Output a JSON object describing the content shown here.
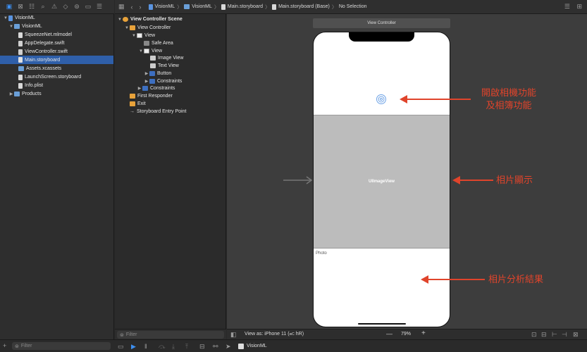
{
  "navigator": {
    "items": [
      {
        "label": "VisionML",
        "type": "project",
        "indent": 0,
        "expanded": true
      },
      {
        "label": "VisionML",
        "type": "folder",
        "indent": 1,
        "expanded": true
      },
      {
        "label": "SqueezeNet.mlmodel",
        "type": "file",
        "indent": 2
      },
      {
        "label": "AppDelegate.swift",
        "type": "swift",
        "indent": 2
      },
      {
        "label": "ViewController.swift",
        "type": "swift",
        "indent": 2
      },
      {
        "label": "Main.storyboard",
        "type": "storyboard",
        "indent": 2,
        "selected": true
      },
      {
        "label": "Assets.xcassets",
        "type": "folder",
        "indent": 2
      },
      {
        "label": "LaunchScreen.storyboard",
        "type": "storyboard",
        "indent": 2
      },
      {
        "label": "Info.plist",
        "type": "file",
        "indent": 2
      },
      {
        "label": "Products",
        "type": "folder",
        "indent": 1,
        "expanded": false
      }
    ],
    "filter_placeholder": "Filter"
  },
  "breadcrumb": [
    "VisionML",
    "VisionML",
    "Main.storyboard",
    "Main.storyboard (Base)",
    "No Selection"
  ],
  "outline": {
    "items": [
      {
        "label": "View Controller Scene",
        "indent": 0
      },
      {
        "label": "View Controller",
        "indent": 1
      },
      {
        "label": "View",
        "indent": 2
      },
      {
        "label": "Safe Area",
        "indent": 3
      },
      {
        "label": "View",
        "indent": 3
      },
      {
        "label": "Image View",
        "indent": 4
      },
      {
        "label": "Text View",
        "indent": 4
      },
      {
        "label": "Button",
        "indent": 4
      },
      {
        "label": "Constraints",
        "indent": 4
      },
      {
        "label": "Constraints",
        "indent": 3
      },
      {
        "label": "First Responder",
        "indent": 1
      },
      {
        "label": "Exit",
        "indent": 1
      },
      {
        "label": "Storyboard Entry Point",
        "indent": 1
      }
    ],
    "filter_placeholder": "Filter"
  },
  "canvas": {
    "scene_title": "View Controller",
    "image_view_label": "UIImageView",
    "text_view_label": "Photo"
  },
  "annotations": {
    "camera": [
      "開啟相機功能",
      "及相簿功能"
    ],
    "photo": "相片顯示",
    "result": "相片分析結果"
  },
  "status": {
    "view_as": "View as: iPhone 11 (",
    "view_as_mid": "wC",
    "view_as_end": " hR)",
    "zoom": "79%"
  },
  "debug": {
    "scheme": "VisionML"
  },
  "colors": {
    "accent": "#3d8ff0",
    "annotation": "#e0442b",
    "selection": "#2f5fa9"
  }
}
